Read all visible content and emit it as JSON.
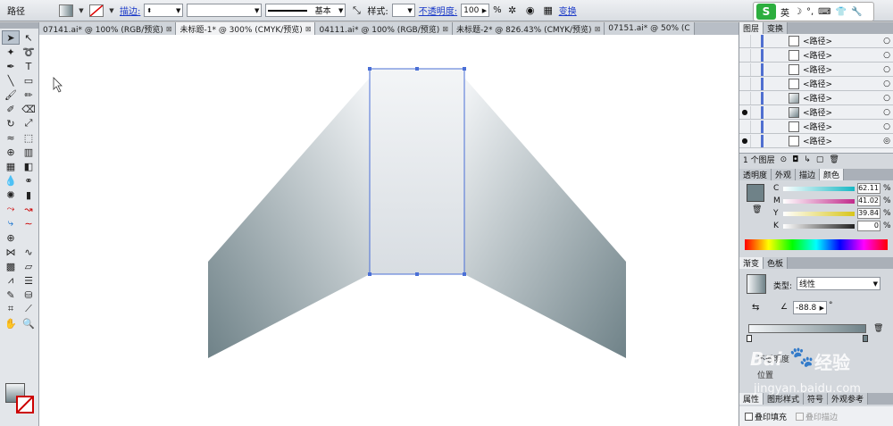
{
  "control_bar": {
    "object_type": "路径",
    "stroke_label": "描边:",
    "stroke_profile": "基本",
    "style_label": "样式:",
    "opacity_label": "不透明度:",
    "opacity_value": "100",
    "opacity_unit": "%",
    "transform_link": "变换"
  },
  "ime": {
    "logo": "S",
    "mode": "英"
  },
  "tabs": [
    {
      "label": "07141.ai* @ 100% (RGB/预览)",
      "active": false
    },
    {
      "label": "未标题-1* @ 300% (CMYK/预览)",
      "active": true
    },
    {
      "label": "04111.ai* @ 100% (RGB/预览)",
      "active": false
    },
    {
      "label": "未标题-2* @ 826.43% (CMYK/预览)",
      "active": false
    },
    {
      "label": "07151.ai* @ 50% (C",
      "active": false
    }
  ],
  "layers_panel": {
    "tabs": [
      "图层",
      "变换"
    ],
    "items": [
      "<路径>",
      "<路径>",
      "<路径>",
      "<路径>",
      "<路径>",
      "<路径>",
      "<路径>",
      "<路径>"
    ],
    "footer": "1 个图层"
  },
  "color_panel": {
    "tabs": [
      "透明度",
      "外观",
      "描边",
      "颜色"
    ],
    "channels": [
      {
        "name": "C",
        "value": "62.11",
        "color": "#17b8c4"
      },
      {
        "name": "M",
        "value": "41.02",
        "color": "#c22a8b"
      },
      {
        "name": "Y",
        "value": "39.84",
        "color": "#d8c51a"
      },
      {
        "name": "K",
        "value": "0",
        "color": "#222222"
      }
    ],
    "unit": "%"
  },
  "gradient_panel": {
    "tabs": [
      "渐变",
      "色板"
    ],
    "type_label": "类型:",
    "type_value": "线性",
    "angle_value": "-88.8",
    "angle_unit": "°",
    "bottom_labels": [
      "不透明度",
      "位置"
    ]
  },
  "bottom_panel": {
    "tabs": [
      "属性",
      "图形样式",
      "符号",
      "外观参考"
    ],
    "overprint_fill": "叠印填充",
    "overprint_stroke": "叠印描边"
  },
  "watermark": {
    "brand": "Bai",
    "suffix": "经验",
    "url": "jingyan.baidu.com"
  },
  "colors": {
    "gradient_light": "#f4f6f8",
    "gradient_dark": "#6f8288",
    "selection": "#4a6fd6"
  }
}
